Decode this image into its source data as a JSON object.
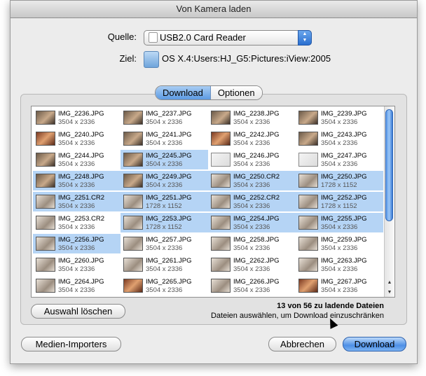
{
  "window": {
    "title": "Von Kamera laden"
  },
  "source": {
    "label": "Quelle:",
    "value": "USB2.0 Card Reader"
  },
  "destination": {
    "label": "Ziel:",
    "path": "OS X.4:Users:HJ_G5:Pictures:iView:2005"
  },
  "tabs": [
    {
      "label": "Download",
      "active": true
    },
    {
      "label": "Optionen",
      "active": false
    }
  ],
  "files": [
    {
      "name": "IMG_2236.JPG",
      "dims": "3504 x 2336",
      "selected": false,
      "thumb": "dark"
    },
    {
      "name": "IMG_2237.JPG",
      "dims": "3504 x 2336",
      "selected": false,
      "thumb": "dark"
    },
    {
      "name": "IMG_2238.JPG",
      "dims": "3504 x 2336",
      "selected": false,
      "thumb": "dark"
    },
    {
      "name": "IMG_2239.JPG",
      "dims": "3504 x 2336",
      "selected": false,
      "thumb": "dark"
    },
    {
      "name": "IMG_2240.JPG",
      "dims": "3504 x 2336",
      "selected": false,
      "thumb": "warm"
    },
    {
      "name": "IMG_2241.JPG",
      "dims": "3504 x 2336",
      "selected": false,
      "thumb": "dark"
    },
    {
      "name": "IMG_2242.JPG",
      "dims": "3504 x 2336",
      "selected": false,
      "thumb": "warm"
    },
    {
      "name": "IMG_2243.JPG",
      "dims": "3504 x 2336",
      "selected": false,
      "thumb": "dark"
    },
    {
      "name": "IMG_2244.JPG",
      "dims": "3504 x 2336",
      "selected": false,
      "thumb": "dark"
    },
    {
      "name": "IMG_2245.JPG",
      "dims": "3504 x 2336",
      "selected": true,
      "thumb": "dark"
    },
    {
      "name": "IMG_2246.JPG",
      "dims": "3504 x 2336",
      "selected": false,
      "thumb": "light"
    },
    {
      "name": "IMG_2247.JPG",
      "dims": "3504 x 2336",
      "selected": false,
      "thumb": "light"
    },
    {
      "name": "IMG_2248.JPG",
      "dims": "3504 x 2336",
      "selected": true,
      "thumb": "dark"
    },
    {
      "name": "IMG_2249.JPG",
      "dims": "3504 x 2336",
      "selected": true,
      "thumb": "dark"
    },
    {
      "name": "IMG_2250.CR2",
      "dims": "3504 x 2336",
      "selected": true,
      "thumb": "mid"
    },
    {
      "name": "IMG_2250.JPG",
      "dims": "1728 x 1152",
      "selected": true,
      "thumb": "mid"
    },
    {
      "name": "IMG_2251.CR2",
      "dims": "3504 x 2336",
      "selected": true,
      "thumb": "mid"
    },
    {
      "name": "IMG_2251.JPG",
      "dims": "1728 x 1152",
      "selected": true,
      "thumb": "mid"
    },
    {
      "name": "IMG_2252.CR2",
      "dims": "3504 x 2336",
      "selected": true,
      "thumb": "mid"
    },
    {
      "name": "IMG_2252.JPG",
      "dims": "1728 x 1152",
      "selected": true,
      "thumb": "mid"
    },
    {
      "name": "IMG_2253.CR2",
      "dims": "3504 x 2336",
      "selected": false,
      "thumb": "mid"
    },
    {
      "name": "IMG_2253.JPG",
      "dims": "1728 x 1152",
      "selected": true,
      "thumb": "mid"
    },
    {
      "name": "IMG_2254.JPG",
      "dims": "3504 x 2336",
      "selected": true,
      "thumb": "mid"
    },
    {
      "name": "IMG_2255.JPG",
      "dims": "3504 x 2336",
      "selected": true,
      "thumb": "mid"
    },
    {
      "name": "IMG_2256.JPG",
      "dims": "3504 x 2336",
      "selected": true,
      "thumb": "mid"
    },
    {
      "name": "IMG_2257.JPG",
      "dims": "3504 x 2336",
      "selected": false,
      "thumb": "mid"
    },
    {
      "name": "IMG_2258.JPG",
      "dims": "3504 x 2336",
      "selected": false,
      "thumb": "mid"
    },
    {
      "name": "IMG_2259.JPG",
      "dims": "3504 x 2336",
      "selected": false,
      "thumb": "mid"
    },
    {
      "name": "IMG_2260.JPG",
      "dims": "3504 x 2336",
      "selected": false,
      "thumb": "mid"
    },
    {
      "name": "IMG_2261.JPG",
      "dims": "3504 x 2336",
      "selected": false,
      "thumb": "mid"
    },
    {
      "name": "IMG_2262.JPG",
      "dims": "3504 x 2336",
      "selected": false,
      "thumb": "mid"
    },
    {
      "name": "IMG_2263.JPG",
      "dims": "3504 x 2336",
      "selected": false,
      "thumb": "mid"
    },
    {
      "name": "IMG_2264.JPG",
      "dims": "3504 x 2336",
      "selected": false,
      "thumb": "mid"
    },
    {
      "name": "IMG_2265.JPG",
      "dims": "3504 x 2336",
      "selected": false,
      "thumb": "warm"
    },
    {
      "name": "IMG_2266.JPG",
      "dims": "3504 x 2336",
      "selected": false,
      "thumb": "mid"
    },
    {
      "name": "IMG_2267.JPG",
      "dims": "3504 x 2336",
      "selected": false,
      "thumb": "warm"
    }
  ],
  "clear_selection_label": "Auswahl löschen",
  "status": {
    "count": "13 von 56 zu ladende Dateien",
    "hint": "Dateien auswählen, um Download einzuschränken"
  },
  "buttons": {
    "media_importers": "Medien-Importers",
    "cancel": "Abbrechen",
    "download": "Download"
  },
  "icons": {
    "device": "card-reader-icon",
    "folder": "folder-icon"
  },
  "colors": {
    "selection": "#b5d4f5",
    "accent": "#4d8fe6"
  }
}
